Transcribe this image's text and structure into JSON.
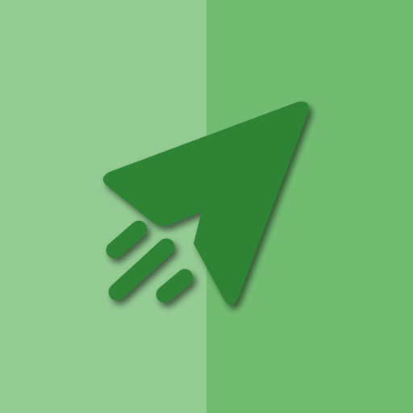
{
  "icon": {
    "name": "paper-plane-send-icon",
    "colors": {
      "background_left": "#93CB93",
      "background_right": "#72BC72",
      "glyph": "#2E8335",
      "shadow": "#1E4D1F"
    }
  }
}
